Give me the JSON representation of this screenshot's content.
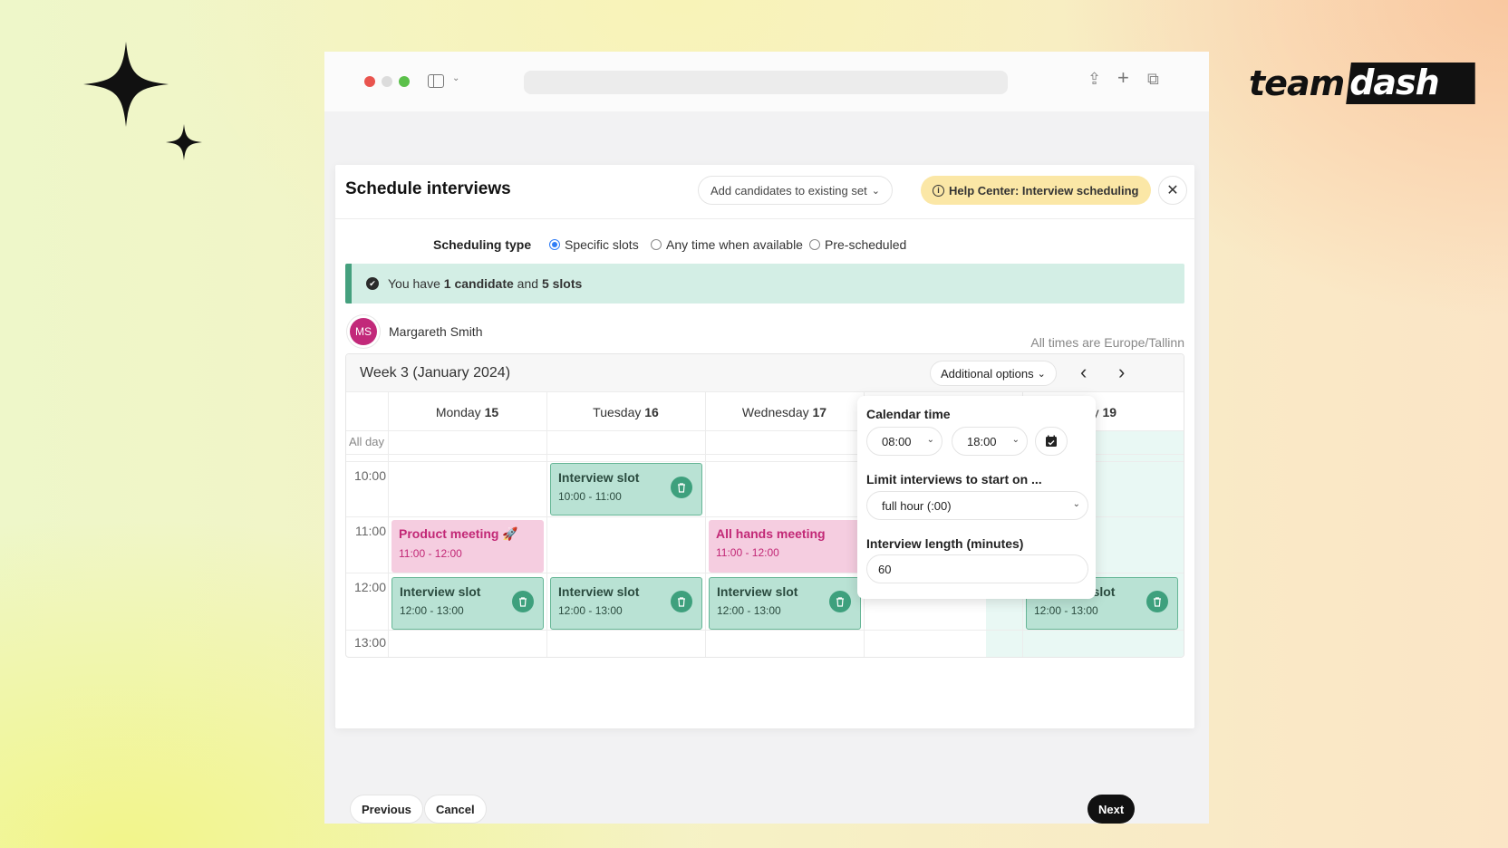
{
  "brand": {
    "logo_left": "team",
    "logo_right": "dash"
  },
  "browser": {
    "url": ""
  },
  "modal": {
    "title": "Schedule interviews",
    "add_candidates_label": "Add candidates to existing set",
    "help_label": "Help Center: Interview scheduling"
  },
  "scheduling": {
    "label": "Scheduling type",
    "options": [
      "Specific slots",
      "Any time when available",
      "Pre-scheduled"
    ],
    "selected": "Specific slots"
  },
  "banner": {
    "prefix": "You have ",
    "count_candidates": "1 candidate",
    "and": " and ",
    "count_slots": "5 slots"
  },
  "candidate": {
    "initials": "MS",
    "name": "Margareth Smith"
  },
  "timezone_note": "All times are Europe/Tallinn",
  "calendar": {
    "week_label": "Week 3 (January 2024)",
    "additional_options_label": "Additional options",
    "all_day_label": "All day",
    "days": [
      {
        "name": "Monday",
        "num": "15"
      },
      {
        "name": "Tuesday",
        "num": "16"
      },
      {
        "name": "Wednesday",
        "num": "17"
      },
      {
        "name": "",
        "num": ""
      },
      {
        "name": "day",
        "num": "19"
      }
    ],
    "times": [
      "10:00",
      "11:00",
      "12:00",
      "13:00"
    ],
    "events": [
      {
        "title": "Interview slot",
        "time": "10:00 - 11:00"
      },
      {
        "title": "Product meeting 🚀",
        "time": "11:00 - 12:00"
      },
      {
        "title": "All hands meeting",
        "time": "11:00 - 12:00"
      },
      {
        "title": "Interview slot",
        "time": "12:00 - 13:00"
      },
      {
        "title": "Interview slot",
        "time": "12:00 - 13:00"
      },
      {
        "title": "Interview slot",
        "time": "12:00 - 13:00"
      },
      {
        "title": "Interview slot",
        "time": "12:00 - 13:00"
      }
    ]
  },
  "popover": {
    "calendar_time_label": "Calendar time",
    "start_time": "08:00",
    "end_time": "18:00",
    "limit_label": "Limit interviews to start on ...",
    "limit_value": "full hour (:00)",
    "length_label": "Interview length (minutes)",
    "length_value": "60"
  },
  "footer": {
    "previous": "Previous",
    "cancel": "Cancel",
    "next": "Next"
  },
  "colors": {
    "slot_bg": "#b9e2d4",
    "slot_accent": "#3ea07d",
    "meeting_bg": "#f5cde0",
    "meeting_text": "#c22876",
    "help_bg": "#fbe7a6",
    "avatar_bg": "#c2297a",
    "radio_selected": "#2f7df6"
  },
  "icons": [
    "sparkle-icon",
    "sidebar-icon",
    "share-icon",
    "plus-icon",
    "tabs-icon",
    "info-icon",
    "close-icon",
    "check-circle-icon",
    "chevron-left-icon",
    "chevron-right-icon",
    "trash-icon",
    "calendar-icon"
  ]
}
